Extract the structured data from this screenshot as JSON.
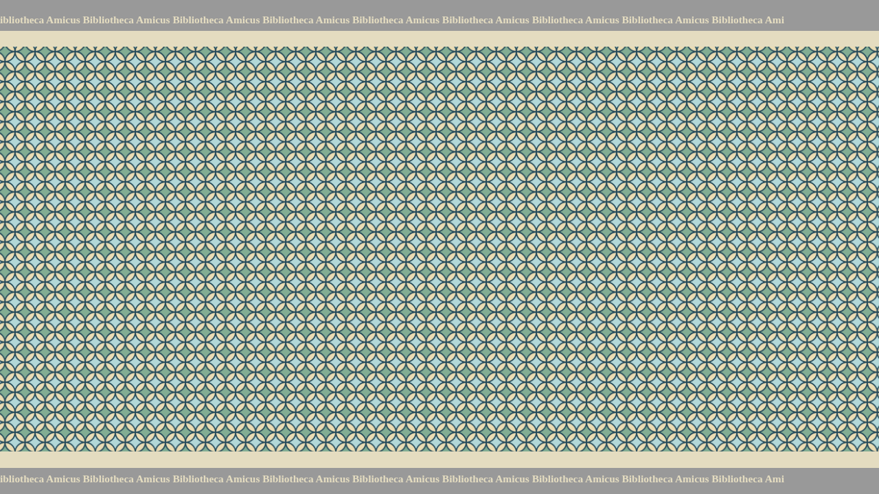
{
  "header": {
    "text": "ibliotheca Amicus Bibliotheca Amicus Bibliotheca Amicus Bibliotheca Amicus Bibliotheca Amicus Bibliotheca Amicus Bibliotheca Amicus Bibliotheca Amicus Bibliotheca Ami"
  },
  "footer": {
    "text": "ibliotheca Amicus Bibliotheca Amicus Bibliotheca Amicus Bibliotheca Amicus Bibliotheca Amicus Bibliotheca Amicus Bibliotheca Amicus Bibliotheca Amicus Bibliotheca Ami"
  }
}
